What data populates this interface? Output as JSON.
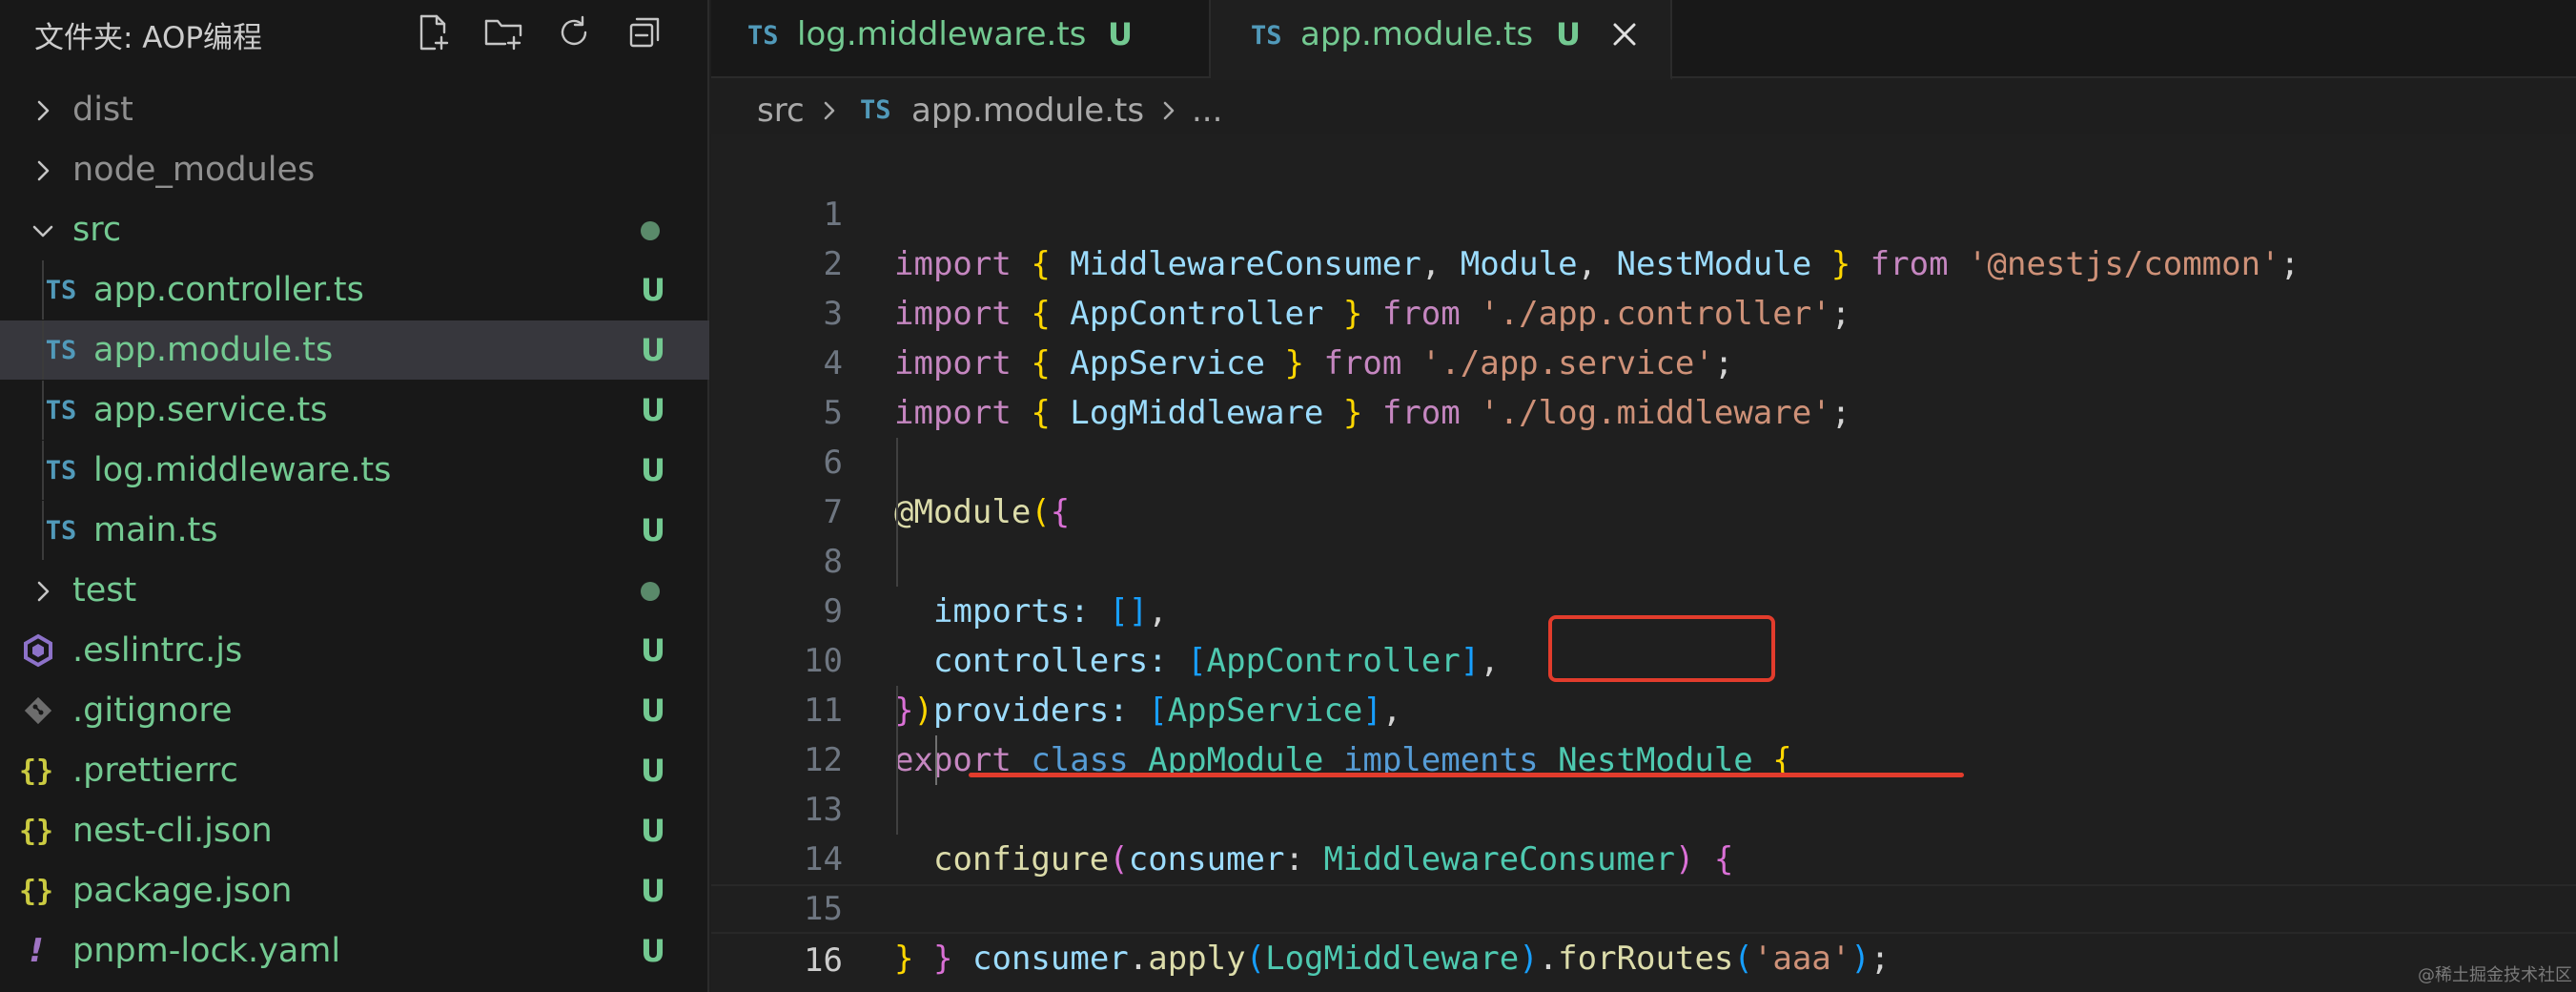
{
  "explorer": {
    "title": "文件夹: AOP编程",
    "actions": [
      "new-file-icon",
      "new-folder-icon",
      "refresh-icon",
      "collapse-all-icon"
    ],
    "items": [
      {
        "label": "dist",
        "kind": "folder"
      },
      {
        "label": "node_modules",
        "kind": "folder"
      },
      {
        "label": "src",
        "kind": "folder-open"
      },
      {
        "label": "app.controller.ts",
        "badge": "U"
      },
      {
        "label": "app.module.ts",
        "badge": "U",
        "selected": true
      },
      {
        "label": "app.service.ts",
        "badge": "U"
      },
      {
        "label": "log.middleware.ts",
        "badge": "U"
      },
      {
        "label": "main.ts",
        "badge": "U"
      },
      {
        "label": "test",
        "kind": "folder"
      },
      {
        "label": ".eslintrc.js",
        "badge": "U"
      },
      {
        "label": ".gitignore",
        "badge": "U"
      },
      {
        "label": ".prettierrc",
        "badge": "U"
      },
      {
        "label": "nest-cli.json",
        "badge": "U"
      },
      {
        "label": "package.json",
        "badge": "U"
      },
      {
        "label": "pnpm-lock.yaml",
        "badge": "U"
      }
    ],
    "ts_icon": "TS",
    "json_icon": "{}",
    "yaml_icon": "!"
  },
  "tabs": [
    {
      "name": "log.middleware.ts",
      "badge": "U",
      "active": false
    },
    {
      "name": "app.module.ts",
      "badge": "U",
      "active": true
    }
  ],
  "breadcrumb": {
    "parts": [
      "src",
      "app.module.ts",
      "..."
    ],
    "ts_icon": "TS"
  },
  "editor": {
    "current_line": 16,
    "line_numbers": [
      "1",
      "2",
      "3",
      "4",
      "5",
      "6",
      "7",
      "8",
      "9",
      "10",
      "11",
      "12",
      "13",
      "14",
      "15",
      "16"
    ],
    "code": {
      "l1": [
        "import",
        "{",
        "MiddlewareConsumer",
        ",",
        "Module",
        ",",
        "NestModule",
        "}",
        "from",
        "'@nestjs/common'",
        ";"
      ],
      "l2": [
        "import",
        "{",
        "AppController",
        "}",
        "from",
        "'./app.controller'",
        ";"
      ],
      "l3": [
        "import",
        "{",
        "AppService",
        "}",
        "from",
        "'./app.service'",
        ";"
      ],
      "l4": [
        "import",
        "{",
        "LogMiddleware",
        "}",
        "from",
        "'./log.middleware'",
        ";"
      ],
      "l6": [
        "@Module",
        "(",
        "{"
      ],
      "l7": [
        "imports",
        ":",
        "[]",
        ","
      ],
      "l8": [
        "controllers",
        ":",
        "[",
        "AppController",
        "]",
        ","
      ],
      "l9": [
        "providers",
        ":",
        "[",
        "AppService",
        "]",
        ","
      ],
      "l10": [
        "}",
        ")"
      ],
      "l11": [
        "export",
        "class",
        "AppModule",
        "implements",
        "NestModule",
        "{"
      ],
      "l12": [
        "configure",
        "(",
        "consumer",
        ":",
        "MiddlewareConsumer",
        ")",
        "{"
      ],
      "l13": [
        "consumer",
        ".",
        "apply",
        "(",
        "LogMiddleware",
        ")",
        ".",
        "forRoutes",
        "(",
        "'aaa'",
        ")",
        ";"
      ],
      "l14": [
        "}"
      ],
      "l15": [
        "}"
      ]
    },
    "annotation_color": "#e23c2c"
  },
  "watermark": "@稀土掘金技术社区",
  "colors": {
    "accent_green": "#73c991",
    "ts_blue": "#519aba",
    "selection": "#37373d"
  }
}
